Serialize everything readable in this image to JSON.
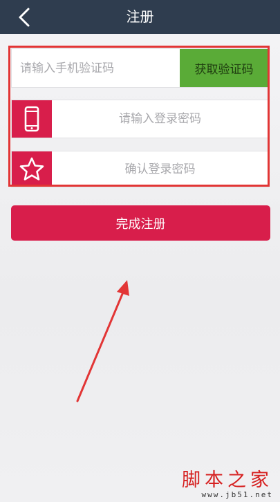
{
  "header": {
    "title": "注册",
    "back_icon": "chevron-left-icon"
  },
  "form": {
    "code_placeholder": "请输入手机验证码",
    "get_code_label": "获取验证码",
    "password_placeholder": "请输入登录密码",
    "confirm_password_placeholder": "确认登录密码",
    "password_icon": "phone-icon",
    "confirm_icon": "star-icon"
  },
  "submit_label": "完成注册",
  "watermark": {
    "text": "脚本之家",
    "url": "www.jb51.net"
  },
  "colors": {
    "header_bg": "#2f3d4f",
    "accent": "#d81e4b",
    "get_code_bg": "#5aab37",
    "highlight": "#e23535",
    "annotation_arrow": "#e23535"
  }
}
